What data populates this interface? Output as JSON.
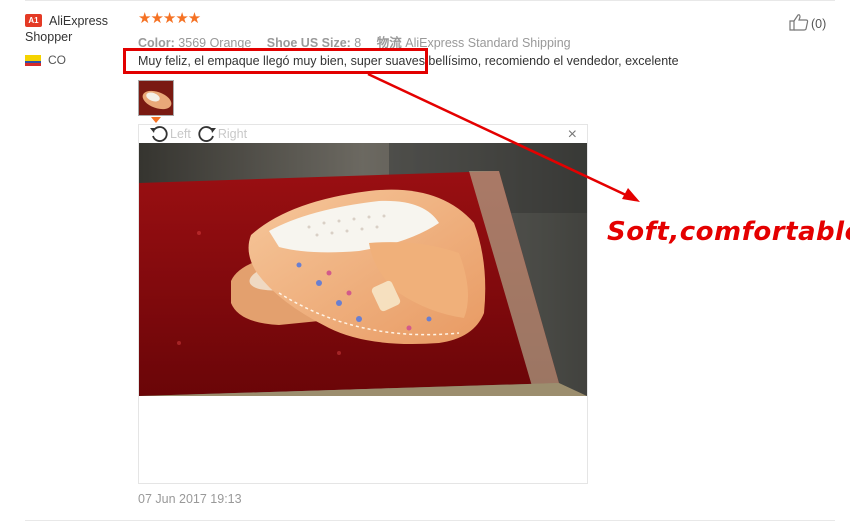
{
  "reviewer": {
    "badge": "A1",
    "name": "AliExpress Shopper",
    "country": "CO"
  },
  "rating": {
    "stars": "★★★★★",
    "value": 5,
    "max": 5
  },
  "attributes": [
    {
      "label": "Color:",
      "value": "3569 Orange"
    },
    {
      "label": "Shoe US Size:",
      "value": "8"
    },
    {
      "label": "物流",
      "value": "AliExpress Standard Shipping"
    }
  ],
  "helpful": {
    "count": "(0)"
  },
  "review": {
    "text": "Muy feliz, el empaque llegó muy bien, super suaves bellísimo, recomiendo el vendedor, excelente",
    "date": "07 Jun 2017 19:13"
  },
  "viewer": {
    "rotate_left": "Left",
    "rotate_right": "Right",
    "close": "×"
  },
  "annotation": {
    "caption": "Soft,comfortable",
    "color": "#e40000"
  },
  "colors": {
    "accent": "#f57224",
    "badge": "#e43a25",
    "muted": "#999999"
  }
}
